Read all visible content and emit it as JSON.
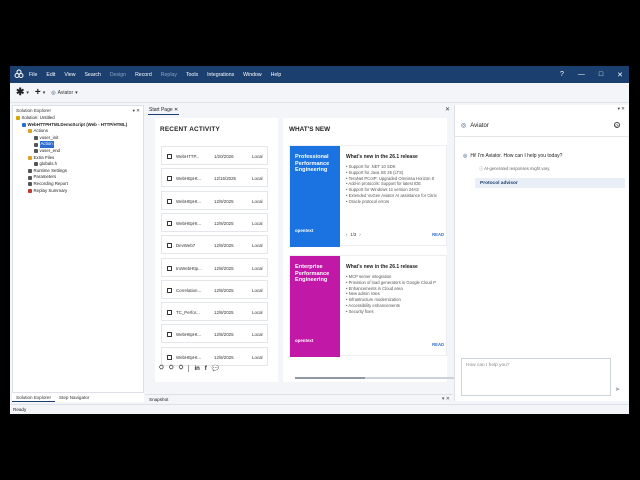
{
  "menu": [
    "File",
    "Edit",
    "View",
    "Search",
    "Design",
    "Record",
    "Replay",
    "Tools",
    "Integrations",
    "Window",
    "Help"
  ],
  "menu_disabled": [
    "Design",
    "Replay"
  ],
  "window_controls": {
    "help": "?",
    "minimize": "—",
    "maximize": "□",
    "close": "✕"
  },
  "toolbar": {
    "new": "✱",
    "add": "+",
    "aviator": "Aviator"
  },
  "explorer": {
    "title": "Solution Explorer",
    "pin": "▾ ✕",
    "tree": [
      {
        "label": "Solution: Untitled",
        "depth": 0
      },
      {
        "label": "WebHTTPHTMLDemoScript (Web - HTTP/HTML)",
        "depth": 1
      },
      {
        "label": "Actions",
        "depth": 2
      },
      {
        "label": "vuser_init",
        "depth": 3
      },
      {
        "label": "Action",
        "depth": 3,
        "selected": true
      },
      {
        "label": "vuser_end",
        "depth": 3
      },
      {
        "label": "Extra Files",
        "depth": 2
      },
      {
        "label": "globals.h",
        "depth": 3
      },
      {
        "label": "Runtime Settings",
        "depth": 2
      },
      {
        "label": "Parameters",
        "depth": 2
      },
      {
        "label": "Recording Report",
        "depth": 2
      },
      {
        "label": "Replay Summary",
        "depth": 2
      }
    ],
    "tabs": [
      "Solution Explorer",
      "Step Navigator"
    ]
  },
  "doc_tab": {
    "label": "Start Page",
    "close": "✕",
    "panel_close": "✕"
  },
  "recent": {
    "title": "RECENT ACTIVITY",
    "rows": [
      {
        "name": "WebHTTP...",
        "date": "1/20/2026",
        "loc": "Local"
      },
      {
        "name": "WebHttpHt...",
        "date": "12/16/2025",
        "loc": "Local"
      },
      {
        "name": "WebHttpHt...",
        "date": "12/9/2025",
        "loc": "Local"
      },
      {
        "name": "WebHttpHt...",
        "date": "12/9/2025",
        "loc": "Local"
      },
      {
        "name": "DevWeb7",
        "date": "12/9/2025",
        "loc": "Local"
      },
      {
        "name": "truWebHttp...",
        "date": "12/8/2025",
        "loc": "Local"
      },
      {
        "name": "Correlation...",
        "date": "12/8/2025",
        "loc": "Local"
      },
      {
        "name": "TC_Perfor...",
        "date": "12/8/2025",
        "loc": "Local"
      },
      {
        "name": "WebHttpHt...",
        "date": "12/8/2025",
        "loc": "Local"
      },
      {
        "name": "WebHttpHt...",
        "date": "12/8/2025",
        "loc": "Local"
      }
    ],
    "social": [
      "in",
      "f",
      "💬"
    ]
  },
  "news": {
    "title": "WHAT'S NEW",
    "cards": [
      {
        "banner": "Professional Performance Engineering",
        "brand": "opentext",
        "color": "#1a73e0",
        "heading": "What's new in the 26.1 release",
        "items": [
          "Support for .NET 10 SDK",
          "Support for Java SE 25 (LTS)",
          "TeraNet PCoIP: Upgraded Omnissa Horizon 8",
          "Add-in protocols: Support for latest IDE",
          "Support for Windows 11 version 24H2",
          "Extended VuGen Aviator AI assistance for Citrix",
          "Oracle protocol errors"
        ],
        "pager": "1/3",
        "read": "READ"
      },
      {
        "banner": "Enterprise Performance Engineering",
        "brand": "opentext",
        "color": "#c218a8",
        "heading": "What's new in the 26.1 release",
        "items": [
          "MCP server integration",
          "Provision of load generators in Google Cloud P",
          "Enhancements in Cloud area",
          "New admin roles",
          "Infrastructure modernization",
          "Accessibility enhancements",
          "Security fixes"
        ],
        "read": "READ"
      }
    ]
  },
  "snapshot": {
    "label": "Snapshot",
    "close": "▾ ✕"
  },
  "aviator": {
    "panel_ctl": "▾ ✕",
    "title": "Aviator",
    "greeting": "Hi! I'm Aviator. How can I help you today?",
    "disclaimer": "AI-generated responses might vary.",
    "suggestion": "Protocol advisor",
    "input_placeholder": "How can I help you?",
    "send": "➤"
  },
  "status": "Ready"
}
